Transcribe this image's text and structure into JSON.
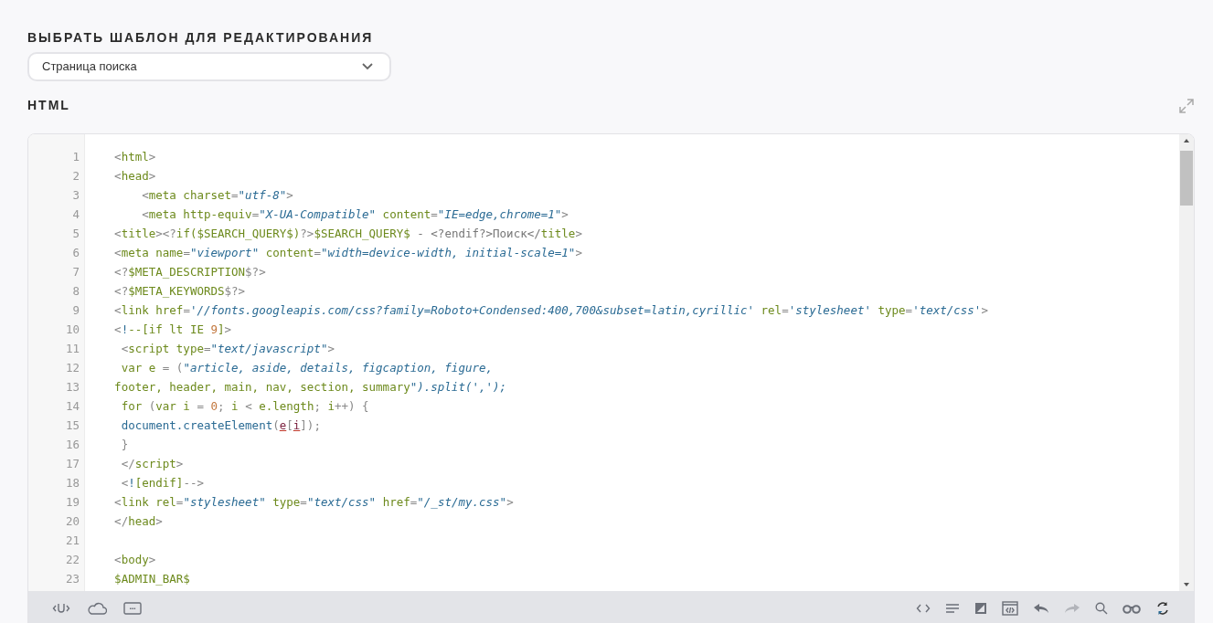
{
  "template_picker": {
    "label": "ВЫБРАТЬ ШАБЛОН ДЛЯ РЕДАКТИРОВАНИЯ",
    "value": "Страница поиска"
  },
  "editor": {
    "title": "HTML",
    "lines": [
      {
        "number": "1",
        "tokens": [
          {
            "kind": "p",
            "text": "    <"
          },
          {
            "kind": "t",
            "text": "html"
          },
          {
            "kind": "p",
            "text": ">"
          }
        ]
      },
      {
        "number": "2",
        "tokens": [
          {
            "kind": "p",
            "text": "    <"
          },
          {
            "kind": "t",
            "text": "head"
          },
          {
            "kind": "p",
            "text": ">"
          }
        ]
      },
      {
        "number": "3",
        "tokens": [
          {
            "kind": "p",
            "text": "        <"
          },
          {
            "kind": "t",
            "text": "meta charset"
          },
          {
            "kind": "p",
            "text": "="
          },
          {
            "kind": "s",
            "text": "\"utf-8\""
          },
          {
            "kind": "p",
            "text": ">"
          }
        ]
      },
      {
        "number": "4",
        "tokens": [
          {
            "kind": "p",
            "text": "        <"
          },
          {
            "kind": "t",
            "text": "meta http-equiv"
          },
          {
            "kind": "p",
            "text": "="
          },
          {
            "kind": "s",
            "text": "\"X-UA-Compatible\""
          },
          {
            "kind": "t",
            "text": " content"
          },
          {
            "kind": "p",
            "text": "="
          },
          {
            "kind": "s",
            "text": "\"IE=edge,chrome=1\""
          },
          {
            "kind": "p",
            "text": ">"
          }
        ]
      },
      {
        "number": "5",
        "tokens": [
          {
            "kind": "p",
            "text": "    <"
          },
          {
            "kind": "t",
            "text": "title"
          },
          {
            "kind": "p",
            "text": "><?"
          },
          {
            "kind": "t",
            "text": "if($SEARCH_QUERY$)"
          },
          {
            "kind": "p",
            "text": "?>"
          },
          {
            "kind": "t",
            "text": "$SEARCH_QUERY$"
          },
          {
            "kind": "x",
            "text": " - <?endif?>Поиск</"
          },
          {
            "kind": "t",
            "text": "title"
          },
          {
            "kind": "p",
            "text": ">"
          }
        ]
      },
      {
        "number": "6",
        "tokens": [
          {
            "kind": "p",
            "text": "    <"
          },
          {
            "kind": "t",
            "text": "meta name"
          },
          {
            "kind": "p",
            "text": "="
          },
          {
            "kind": "s",
            "text": "\"viewport\""
          },
          {
            "kind": "t",
            "text": " content"
          },
          {
            "kind": "p",
            "text": "="
          },
          {
            "kind": "s",
            "text": "\"width=device-width, initial-scale=1\""
          },
          {
            "kind": "p",
            "text": ">"
          }
        ]
      },
      {
        "number": "7",
        "tokens": [
          {
            "kind": "p",
            "text": "    <?"
          },
          {
            "kind": "t",
            "text": "$META_DESCRIPTION"
          },
          {
            "kind": "p",
            "text": "$?>"
          }
        ]
      },
      {
        "number": "8",
        "tokens": [
          {
            "kind": "p",
            "text": "    <?"
          },
          {
            "kind": "t",
            "text": "$META_KEYWORDS"
          },
          {
            "kind": "p",
            "text": "$?>"
          }
        ]
      },
      {
        "number": "9",
        "tokens": [
          {
            "kind": "p",
            "text": "    <"
          },
          {
            "kind": "t",
            "text": "link href"
          },
          {
            "kind": "p",
            "text": "="
          },
          {
            "kind": "s",
            "text": "'//fonts.googleapis.com/css?family=Roboto+Condensed:400,700&subset=latin,cyrillic'"
          },
          {
            "kind": "t",
            "text": " rel"
          },
          {
            "kind": "p",
            "text": "="
          },
          {
            "kind": "s",
            "text": "'stylesheet'"
          },
          {
            "kind": "t",
            "text": " type"
          },
          {
            "kind": "p",
            "text": "="
          },
          {
            "kind": "s",
            "text": "'text/css'"
          },
          {
            "kind": "p",
            "text": ">"
          }
        ]
      },
      {
        "number": "10",
        "tokens": [
          {
            "kind": "p",
            "text": "    <"
          },
          {
            "kind": "f",
            "text": "!"
          },
          {
            "kind": "t",
            "text": "--[if lt IE "
          },
          {
            "kind": "n",
            "text": "9"
          },
          {
            "kind": "t",
            "text": "]"
          },
          {
            "kind": "p",
            "text": ">"
          }
        ]
      },
      {
        "number": "11",
        "tokens": [
          {
            "kind": "p",
            "text": "     <"
          },
          {
            "kind": "t",
            "text": "script type"
          },
          {
            "kind": "p",
            "text": "="
          },
          {
            "kind": "s",
            "text": "\"text/javascript\""
          },
          {
            "kind": "p",
            "text": ">"
          }
        ]
      },
      {
        "number": "12",
        "tokens": [
          {
            "kind": "t",
            "text": "     var e "
          },
          {
            "kind": "p",
            "text": "= ("
          },
          {
            "kind": "s",
            "text": "\"article, aside, details, figcaption, figure,"
          }
        ]
      },
      {
        "number": "13",
        "tokens": [
          {
            "kind": "t",
            "text": "    footer, header, main, nav, section, summary"
          },
          {
            "kind": "s",
            "text": "\").split(',');"
          }
        ]
      },
      {
        "number": "14",
        "tokens": [
          {
            "kind": "t",
            "text": "     for "
          },
          {
            "kind": "p",
            "text": "("
          },
          {
            "kind": "t",
            "text": "var i "
          },
          {
            "kind": "p",
            "text": "= "
          },
          {
            "kind": "n",
            "text": "0"
          },
          {
            "kind": "p",
            "text": "; "
          },
          {
            "kind": "t",
            "text": "i "
          },
          {
            "kind": "p",
            "text": "< "
          },
          {
            "kind": "t",
            "text": "e.length"
          },
          {
            "kind": "p",
            "text": "; "
          },
          {
            "kind": "t",
            "text": "i"
          },
          {
            "kind": "p",
            "text": "++) {"
          }
        ]
      },
      {
        "number": "15",
        "tokens": [
          {
            "kind": "f",
            "text": "     document.createElement"
          },
          {
            "kind": "p",
            "text": "("
          },
          {
            "kind": "u",
            "text": "e"
          },
          {
            "kind": "p",
            "text": "["
          },
          {
            "kind": "u",
            "text": "i"
          },
          {
            "kind": "p",
            "text": "]);"
          }
        ]
      },
      {
        "number": "16",
        "tokens": [
          {
            "kind": "p",
            "text": "     }"
          }
        ]
      },
      {
        "number": "17",
        "tokens": [
          {
            "kind": "p",
            "text": "     </"
          },
          {
            "kind": "t",
            "text": "script"
          },
          {
            "kind": "p",
            "text": ">"
          }
        ]
      },
      {
        "number": "18",
        "tokens": [
          {
            "kind": "p",
            "text": "     <"
          },
          {
            "kind": "f",
            "text": "!"
          },
          {
            "kind": "t",
            "text": "[endif]"
          },
          {
            "kind": "p",
            "text": "-->"
          }
        ]
      },
      {
        "number": "19",
        "tokens": [
          {
            "kind": "p",
            "text": "    <"
          },
          {
            "kind": "t",
            "text": "link rel"
          },
          {
            "kind": "p",
            "text": "="
          },
          {
            "kind": "s",
            "text": "\"stylesheet\""
          },
          {
            "kind": "t",
            "text": " type"
          },
          {
            "kind": "p",
            "text": "="
          },
          {
            "kind": "s",
            "text": "\"text/css\""
          },
          {
            "kind": "t",
            "text": " href"
          },
          {
            "kind": "p",
            "text": "="
          },
          {
            "kind": "s",
            "text": "\"/_st/my.css\""
          },
          {
            "kind": "p",
            "text": ">"
          }
        ]
      },
      {
        "number": "20",
        "tokens": [
          {
            "kind": "p",
            "text": "    </"
          },
          {
            "kind": "t",
            "text": "head"
          },
          {
            "kind": "p",
            "text": ">"
          }
        ]
      },
      {
        "number": "21"
      },
      {
        "number": "22",
        "tokens": [
          {
            "kind": "p",
            "text": "    <"
          },
          {
            "kind": "t",
            "text": "body"
          },
          {
            "kind": "p",
            "text": ">"
          }
        ]
      },
      {
        "number": "23",
        "tokens": [
          {
            "kind": "t",
            "text": "    $ADMIN_BAR$"
          }
        ]
      }
    ],
    "toolbar_left": [
      {
        "kind": "shortcode"
      },
      {
        "kind": "cloud"
      },
      {
        "kind": "dots"
      }
    ],
    "toolbar_right": [
      {
        "kind": "code",
        "disabled": false
      },
      {
        "kind": "align",
        "disabled": false
      },
      {
        "kind": "contrast",
        "disabled": false
      },
      {
        "kind": "window",
        "disabled": false
      },
      {
        "kind": "undo",
        "disabled": false
      },
      {
        "kind": "redo",
        "disabled": true
      },
      {
        "kind": "search",
        "disabled": false
      },
      {
        "kind": "binoculars",
        "disabled": false
      },
      {
        "kind": "refresh",
        "disabled": false
      }
    ]
  }
}
